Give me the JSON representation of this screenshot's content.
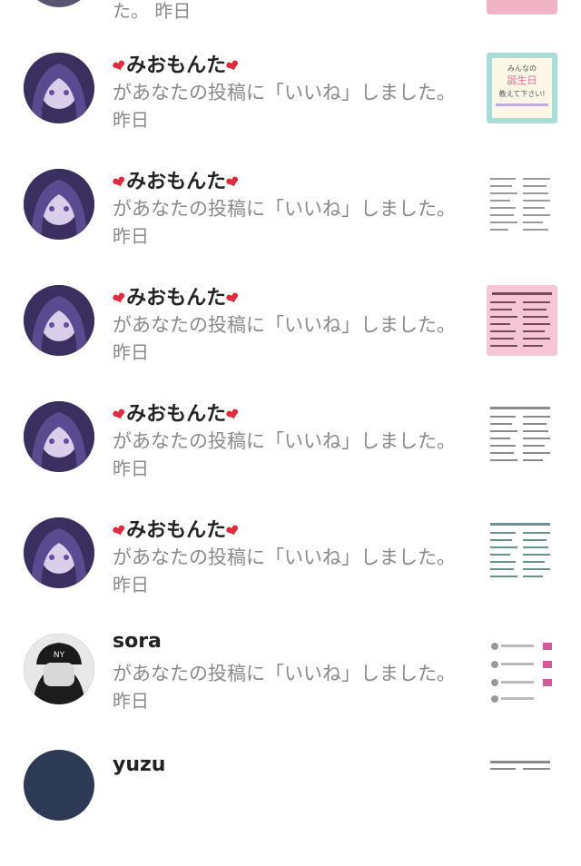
{
  "notifications": [
    {
      "name": "",
      "message": "",
      "time": "た。 昨日",
      "thumb": "pink-banner"
    },
    {
      "name": "みおもんた",
      "message": "があなたの投稿に「いいね」しました。",
      "time": "昨日",
      "thumb": "birthday-card",
      "thumb_text": "みんなの誕生日 教えて下さい!"
    },
    {
      "name": "みおもんた",
      "message": "があなたの投稿に「いいね」しました。",
      "time": "昨日",
      "thumb": "text-list"
    },
    {
      "name": "みおもんた",
      "message": "があなたの投稿に「いいね」しました。",
      "time": "昨日",
      "thumb": "pink-list"
    },
    {
      "name": "みおもんた",
      "message": "があなたの投稿に「いいね」しました。",
      "time": "昨日",
      "thumb": "text-list"
    },
    {
      "name": "みおもんた",
      "message": "があなたの投稿に「いいね」しました。",
      "time": "昨日",
      "thumb": "text-list"
    },
    {
      "name": "sora",
      "message": "があなたの投稿に「いいね」しました。",
      "time": "昨日",
      "thumb": "chat-list"
    },
    {
      "name": "yuzu",
      "message": "",
      "time": "",
      "thumb": "text-list"
    }
  ],
  "colors": {
    "heart": "#e02b3e",
    "secondary_text": "#8a8a8a",
    "avatar_purple": "#3c3360"
  }
}
